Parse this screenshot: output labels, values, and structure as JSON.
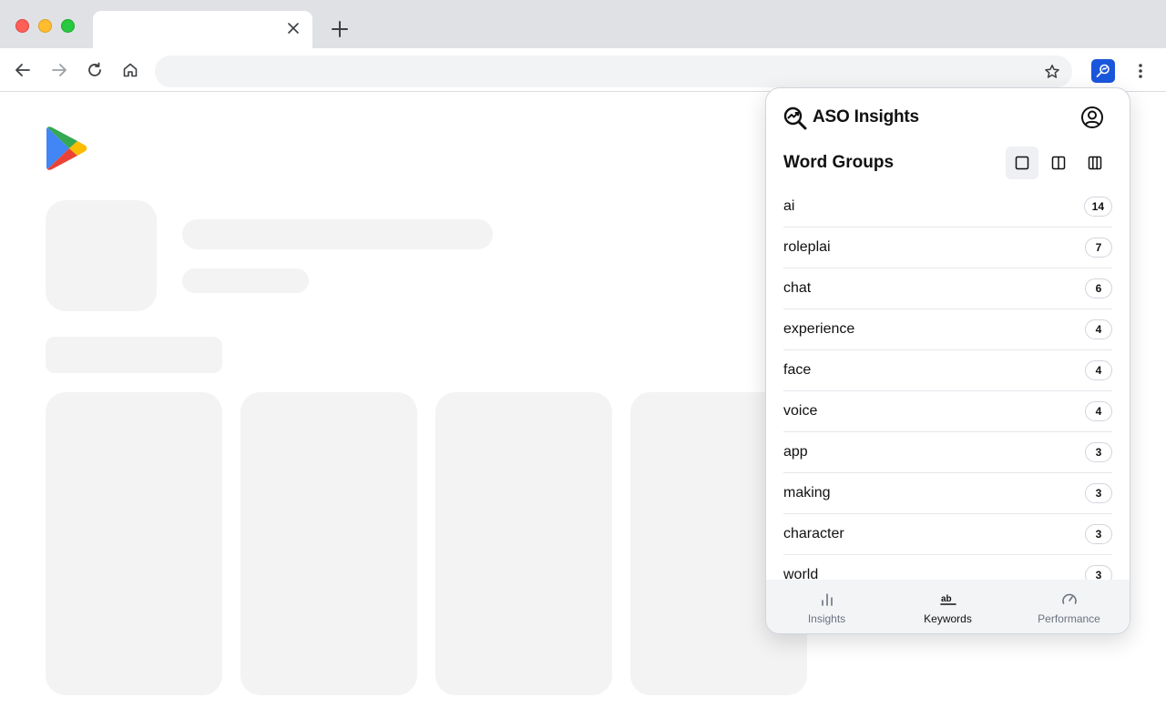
{
  "browser": {
    "tab_title": "",
    "address": ""
  },
  "popup": {
    "brand_title": "ASO Insights",
    "section_title": "Word Groups",
    "word_groups": [
      {
        "word": "ai",
        "count": "14"
      },
      {
        "word": "roleplai",
        "count": "7"
      },
      {
        "word": "chat",
        "count": "6"
      },
      {
        "word": "experience",
        "count": "4"
      },
      {
        "word": "face",
        "count": "4"
      },
      {
        "word": "voice",
        "count": "4"
      },
      {
        "word": "app",
        "count": "3"
      },
      {
        "word": "making",
        "count": "3"
      },
      {
        "word": "character",
        "count": "3"
      },
      {
        "word": "world",
        "count": "3"
      }
    ],
    "nav": [
      {
        "label": "Insights",
        "icon": "bar-chart-icon",
        "active": false
      },
      {
        "label": "Keywords",
        "icon": "ab-text-icon",
        "active": true
      },
      {
        "label": "Performance",
        "icon": "gauge-icon",
        "active": false
      }
    ],
    "colors": {
      "extension_accent": "#1a56db",
      "nav_background": "#f3f4f6"
    }
  }
}
